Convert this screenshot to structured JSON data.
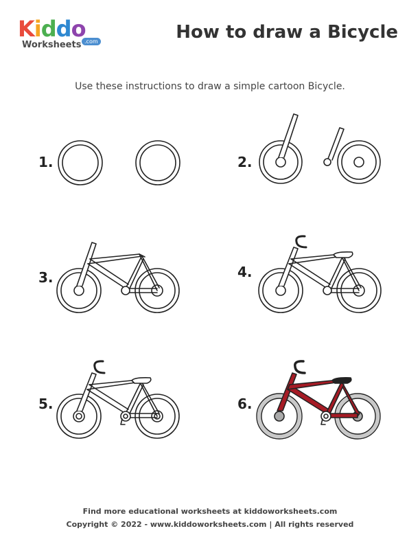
{
  "logo": {
    "kiddo_letters": [
      "K",
      "i",
      "d",
      "d",
      "o"
    ],
    "kiddo_colors": [
      "#e94b3c",
      "#f5a623",
      "#4caf50",
      "#2e88d1",
      "#8e44ad"
    ],
    "worksheets": "Worksheets",
    "dotcom": ".com"
  },
  "title": "How to draw a Bicycle",
  "subtitle": "Use these instructions to draw a simple cartoon Bicycle.",
  "steps": [
    {
      "number": "1."
    },
    {
      "number": "2."
    },
    {
      "number": "3."
    },
    {
      "number": "4."
    },
    {
      "number": "5."
    },
    {
      "number": "6."
    }
  ],
  "colors": {
    "frame_final": "#a61b25",
    "tire_final": "#c8c8c8",
    "ink": "#222222"
  },
  "footer": {
    "line1": "Find more educational worksheets at kiddoworksheets.com",
    "line2": "Copyright © 2022 - www.kiddoworksheets.com  |  All rights reserved"
  }
}
